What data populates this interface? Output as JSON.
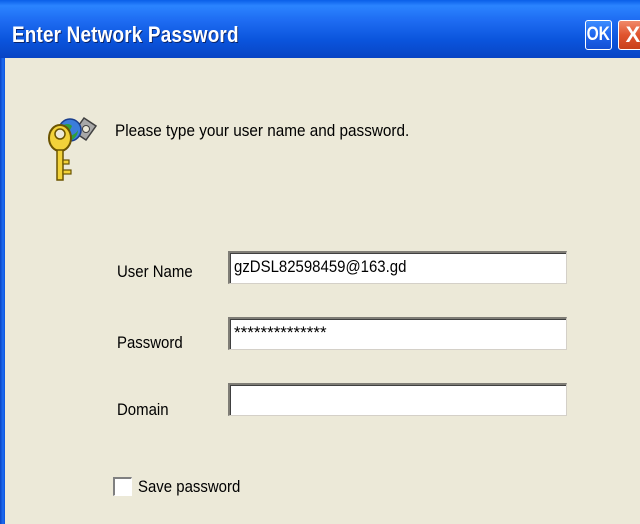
{
  "window": {
    "title": "Enter Network Password",
    "ok_label": "OK",
    "close_symbol": "X"
  },
  "dialog": {
    "prompt": "Please type your user name and password.",
    "icon": "keys-icon",
    "fields": [
      {
        "label": "User Name",
        "value": "gzDSL82598459@163.gd"
      },
      {
        "label": "Password",
        "value": "**************"
      },
      {
        "label": "Domain",
        "value": ""
      }
    ],
    "save_password": {
      "label": "Save password",
      "checked": false
    }
  },
  "colors": {
    "titlebar": "#0A54DC",
    "close_button": "#E0542E",
    "dialog_bg": "#ECE9D8"
  }
}
